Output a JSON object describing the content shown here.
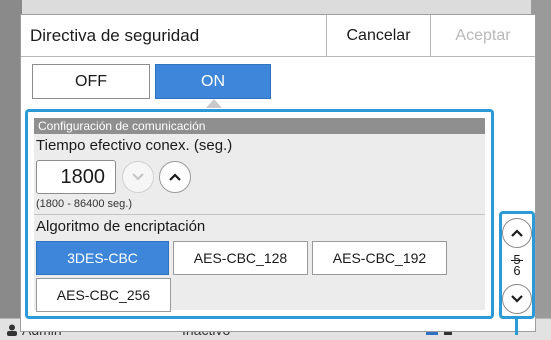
{
  "background": {
    "user_label": "Admin",
    "status_label": "Inactivo"
  },
  "dialog": {
    "title": "Directiva de seguridad",
    "cancel_label": "Cancelar",
    "accept_label": "Aceptar"
  },
  "toggle": {
    "off_label": "OFF",
    "on_label": "ON",
    "selected": "ON"
  },
  "communication": {
    "section_title": "Configuración de comunicación",
    "timeout_label": "Tiempo efectivo conex. (seg.)",
    "timeout_value": "1800",
    "timeout_range": "(1800 - 86400 seg.)",
    "algorithm_label": "Algoritmo de encriptación",
    "algorithms": [
      "3DES-CBC",
      "AES-CBC_128",
      "AES-CBC_192",
      "AES-CBC_256"
    ],
    "selected_algorithm": "3DES-CBC"
  },
  "pager": {
    "current_page": "5",
    "total_pages": "6"
  },
  "colors": {
    "accent": "#3d86d9",
    "focus_outline": "#2b9ad6",
    "section_header": "#8f8f8f"
  }
}
